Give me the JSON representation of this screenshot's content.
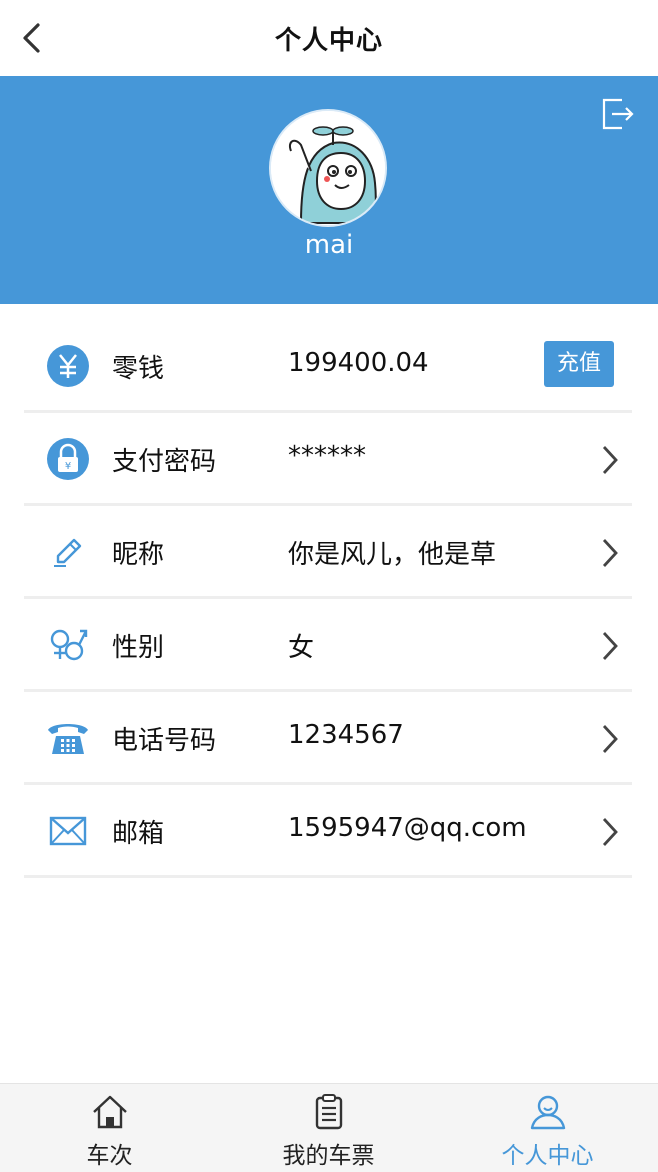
{
  "nav": {
    "title": "个人中心"
  },
  "profile": {
    "username": "mai"
  },
  "rows": [
    {
      "icon": "yen-coin-icon",
      "label": "零钱",
      "value": "199400.04",
      "action": "充值"
    },
    {
      "icon": "lock-icon",
      "label": "支付密码",
      "value": "******"
    },
    {
      "icon": "pencil-icon",
      "label": "昵称",
      "value": "你是风儿，他是草"
    },
    {
      "icon": "gender-icon",
      "label": "性别",
      "value": "女"
    },
    {
      "icon": "telephone-icon",
      "label": "电话号码",
      "value": "1234567"
    },
    {
      "icon": "mail-icon",
      "label": "邮箱",
      "value": "1595947@qq.com"
    }
  ],
  "tabbar": [
    {
      "icon": "home-icon",
      "label": "车次"
    },
    {
      "icon": "clipboard-icon",
      "label": "我的车票"
    },
    {
      "icon": "user-icon",
      "label": "个人中心",
      "active": true
    }
  ],
  "colors": {
    "accent": "#4697d8"
  }
}
